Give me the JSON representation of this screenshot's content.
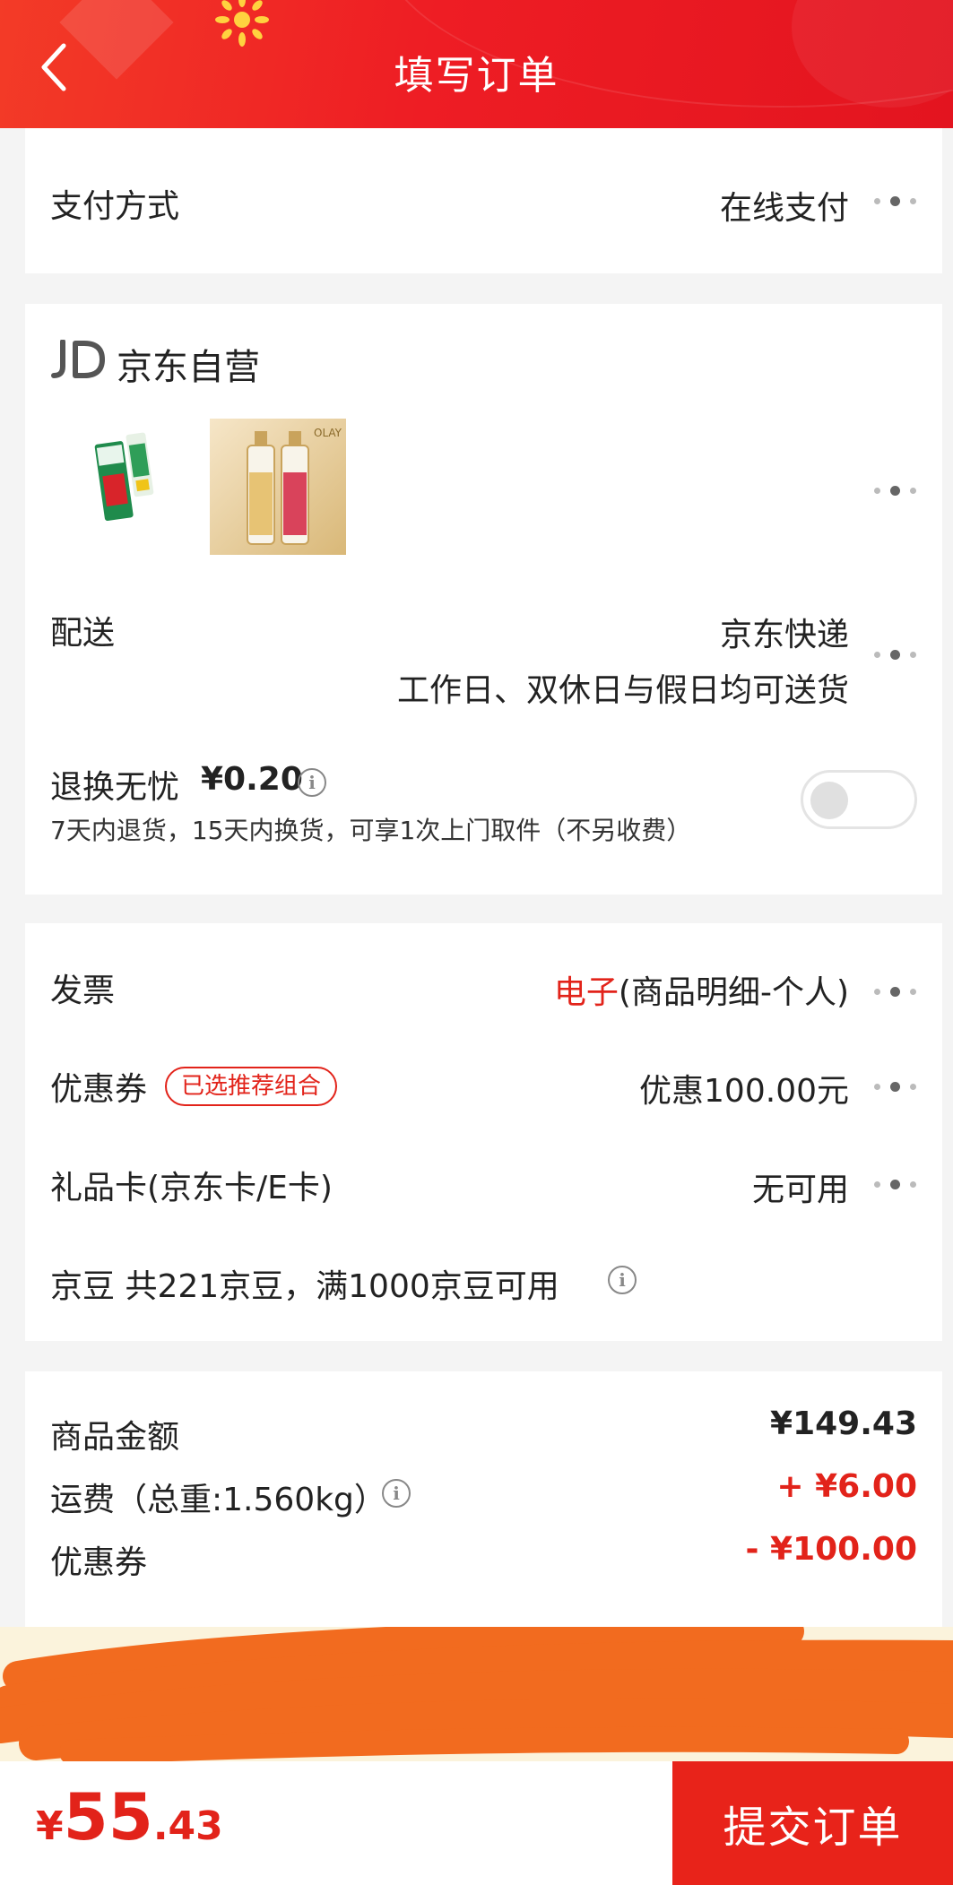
{
  "header": {
    "title": "填写订单"
  },
  "payment": {
    "label": "支付方式",
    "value": "在线支付"
  },
  "shop": {
    "name": "京东自营",
    "products": [
      {
        "name": "中华牙膏"
      },
      {
        "name": "OLAY"
      }
    ],
    "delivery": {
      "label": "配送",
      "carrier": "京东快递",
      "schedule": "工作日、双休日与假日均可送货"
    },
    "return_service": {
      "label": "退换无忧",
      "price": "¥0.20",
      "desc": "7天内退货，15天内换货，可享1次上门取件（不另收费）",
      "enabled": false
    }
  },
  "invoice": {
    "label": "发票",
    "type": "电子",
    "detail": "(商品明细-个人)"
  },
  "coupon": {
    "label": "优惠券",
    "tag": "已选推荐组合",
    "value": "优惠100.00元"
  },
  "giftcard": {
    "label": "礼品卡(京东卡/E卡)",
    "value": "无可用"
  },
  "jingdou": {
    "label": "京豆 共221京豆，满1000京豆可用"
  },
  "summary": {
    "goods_label": "商品金额",
    "goods_value": "¥149.43",
    "freight_label": "运费（总重:1.560kg）",
    "freight_value": "+ ¥6.00",
    "coupon_label": "优惠券",
    "coupon_value": "- ¥100.00"
  },
  "bottom": {
    "currency": "¥",
    "total_int": "55",
    "total_dec": ".43",
    "submit_label": "提交订单"
  },
  "colors": {
    "accent": "#e2231a",
    "header": "#ee1d24"
  }
}
